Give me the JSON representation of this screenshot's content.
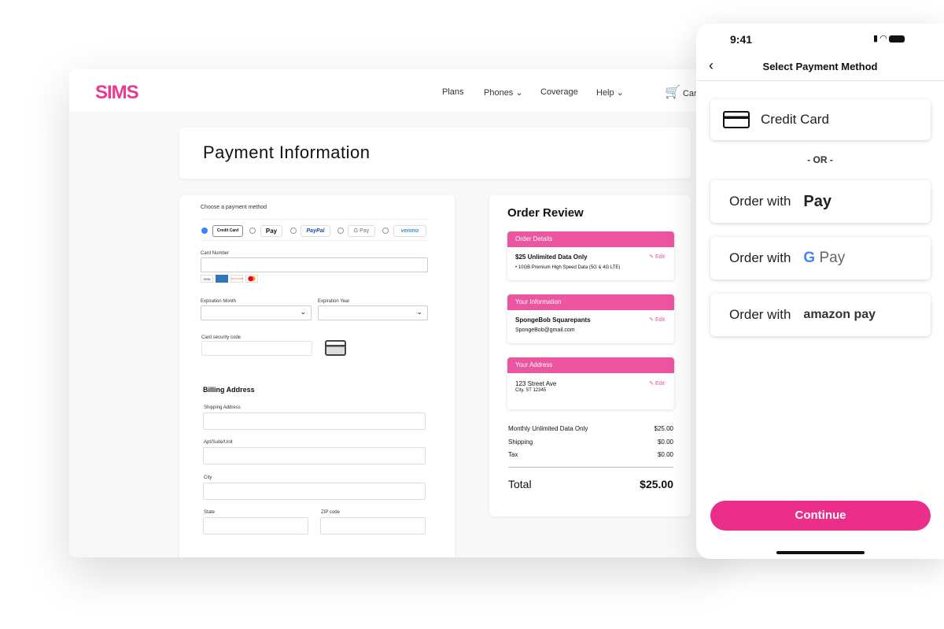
{
  "brand": "SIMS",
  "nav": {
    "plans": "Plans",
    "phones": "Phones",
    "coverage": "Coverage",
    "help": "Help",
    "cart": "Cart"
  },
  "page_title": "Payment Information",
  "payment": {
    "choose": "Choose a payment method",
    "methods": [
      "Credit Card",
      "Pay",
      "PayPal",
      "G Pay",
      "venmo"
    ],
    "selected": 0,
    "card_number": "Card Number",
    "card_brands": [
      "VISA",
      "AMEX",
      "DISCOVER",
      "MC"
    ],
    "exp_month": "Expiration Month",
    "exp_year": "Expiration Year",
    "cvc": "Card security code"
  },
  "billing": {
    "title": "Billing Address",
    "shipping": "Shipping Address",
    "apt": "Apt/Suite/Unit",
    "city": "City",
    "state": "State",
    "zip": "ZIP code"
  },
  "review": {
    "title": "Order Review",
    "edit": "Edit",
    "order_details": {
      "header": "Order Details",
      "plan": "$25 Unlimited Data Only",
      "bullet": "10GB Premium High Speed Data (5G & 4G LTE)"
    },
    "info": {
      "header": "Your Information",
      "name": "SpongeBob Squarepants",
      "email": "SpongeBob@gmail.com"
    },
    "address": {
      "header": "Your Address",
      "line1": "123 Street Ave",
      "line2": "City, ST 12345"
    },
    "lines": [
      {
        "label": "Monthly Unlimited Data Only",
        "value": "$25.00"
      },
      {
        "label": "Shipping",
        "value": "$0.00"
      },
      {
        "label": "Tax",
        "value": "$0.00"
      }
    ],
    "total_label": "Total",
    "total": "$25.00"
  },
  "phone": {
    "time": "9:41",
    "title": "Select Payment Method",
    "credit": "Credit Card",
    "or": "- OR -",
    "order_with": "Order with",
    "apple": "Pay",
    "google": "Pay",
    "amazon": "amazon pay",
    "continue": "Continue"
  },
  "colors": {
    "accent": "#ea2e8a",
    "header_pink": "#ec559f"
  }
}
